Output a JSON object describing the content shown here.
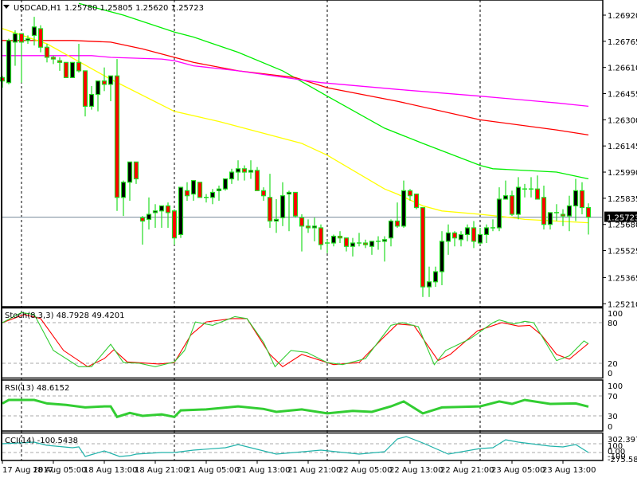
{
  "header": {
    "symbol": "USDCAD,H1",
    "ohlc": "1.25780 1.25805 1.25620 1.25723"
  },
  "colors": {
    "bull_body": "#000000",
    "bear_body": "#ff0000",
    "candle_outline": "#22dd22",
    "ma_green": "#00ee00",
    "ma_red": "#ff0000",
    "ma_magenta": "#ff00ff",
    "ma_yellow": "#ffff00",
    "stoch_main": "#32cd32",
    "stoch_signal": "#ff0000",
    "rsi": "#32cd32",
    "cci": "#20b2aa",
    "last_price_line": "#778899"
  },
  "price_axis": {
    "labels": [
      "1.26920",
      "1.26765",
      "1.26610",
      "1.26455",
      "1.26300",
      "1.26145",
      "1.25990",
      "1.25835",
      "1.25680",
      "1.25525",
      "1.25365",
      "1.25210"
    ],
    "last_price": "1.25723"
  },
  "time_axis": {
    "labels": [
      {
        "text": "17 Aug 2017",
        "candle": 0
      },
      {
        "text": "18 Aug 05:00",
        "candle": 8
      },
      {
        "text": "18 Aug 13:00",
        "candle": 16
      },
      {
        "text": "18 Aug 21:00",
        "candle": 24
      },
      {
        "text": "21 Aug 05:00",
        "candle": 32
      },
      {
        "text": "21 Aug 13:00",
        "candle": 40
      },
      {
        "text": "21 Aug 21:00",
        "candle": 48
      },
      {
        "text": "22 Aug 05:00",
        "candle": 56
      },
      {
        "text": "22 Aug 13:00",
        "candle": 64
      },
      {
        "text": "22 Aug 21:00",
        "candle": 72
      },
      {
        "text": "23 Aug 05:00",
        "candle": 80
      },
      {
        "text": "23 Aug 13:00",
        "candle": 88
      }
    ],
    "day_separators": [
      3,
      27,
      51,
      75
    ]
  },
  "chart_data": {
    "type": "candlestick",
    "title": "USDCAD,H1",
    "ylim": [
      1.2521,
      1.2692
    ],
    "candles": [
      [
        1.2655,
        1.2656,
        1.2649,
        1.2653
      ],
      [
        1.2652,
        1.2678,
        1.2651,
        1.2677
      ],
      [
        1.2676,
        1.2683,
        1.2662,
        1.2681
      ],
      [
        1.2681,
        1.2681,
        1.2652,
        1.2676
      ],
      [
        1.2677,
        1.268,
        1.2675,
        1.2678
      ],
      [
        1.268,
        1.2691,
        1.2674,
        1.2685
      ],
      [
        1.2684,
        1.2686,
        1.267,
        1.2673
      ],
      [
        1.2673,
        1.2675,
        1.2664,
        1.2667
      ],
      [
        1.2667,
        1.2668,
        1.2663,
        1.2666
      ],
      [
        1.2665,
        1.2667,
        1.2659,
        1.2664
      ],
      [
        1.2664,
        1.2664,
        1.2655,
        1.2655
      ],
      [
        1.2655,
        1.2664,
        1.2655,
        1.2664
      ],
      [
        1.2664,
        1.2675,
        1.2658,
        1.2659
      ],
      [
        1.2659,
        1.2659,
        1.2632,
        1.2638
      ],
      [
        1.2638,
        1.265,
        1.2636,
        1.2645
      ],
      [
        1.2645,
        1.2653,
        1.2635,
        1.2653
      ],
      [
        1.2653,
        1.2661,
        1.2647,
        1.2651
      ],
      [
        1.2651,
        1.2656,
        1.2641,
        1.2656
      ],
      [
        1.2656,
        1.2666,
        1.2576,
        1.2584
      ],
      [
        1.2584,
        1.2594,
        1.2573,
        1.2593
      ],
      [
        1.2593,
        1.2605,
        1.2582,
        1.2605
      ],
      [
        1.2605,
        1.2605,
        1.2592,
        1.2595
      ],
      [
        1.2572,
        1.2573,
        1.2556,
        1.257
      ],
      [
        1.2571,
        1.2584,
        1.2565,
        1.2574
      ],
      [
        1.2575,
        1.258,
        1.2566,
        1.2576
      ],
      [
        1.2576,
        1.2579,
        1.2566,
        1.2579
      ],
      [
        1.2579,
        1.2581,
        1.2566,
        1.2575
      ],
      [
        1.2576,
        1.2577,
        1.2556,
        1.256
      ],
      [
        1.2562,
        1.259,
        1.256,
        1.259
      ],
      [
        1.2588,
        1.2593,
        1.2582,
        1.2585
      ],
      [
        1.2586,
        1.2594,
        1.2582,
        1.2594
      ],
      [
        1.2593,
        1.2593,
        1.2584,
        1.2584
      ],
      [
        1.2584,
        1.2586,
        1.2581,
        1.2584
      ],
      [
        1.2584,
        1.2589,
        1.258,
        1.2587
      ],
      [
        1.2588,
        1.2591,
        1.2582,
        1.2589
      ],
      [
        1.2589,
        1.2595,
        1.2588,
        1.2595
      ],
      [
        1.2595,
        1.2601,
        1.2592,
        1.2599
      ],
      [
        1.2599,
        1.2606,
        1.2594,
        1.2601
      ],
      [
        1.2601,
        1.2603,
        1.2594,
        1.2599
      ],
      [
        1.2599,
        1.2606,
        1.2595,
        1.26
      ],
      [
        1.26,
        1.2602,
        1.2588,
        1.2588
      ],
      [
        1.2588,
        1.259,
        1.2582,
        1.2585
      ],
      [
        1.2584,
        1.2598,
        1.2566,
        1.257
      ],
      [
        1.257,
        1.2583,
        1.2563,
        1.2571
      ],
      [
        1.2572,
        1.2593,
        1.2567,
        1.2585
      ],
      [
        1.2586,
        1.2588,
        1.2564,
        1.2587
      ],
      [
        1.2587,
        1.2587,
        1.2572,
        1.2573
      ],
      [
        1.2572,
        1.2574,
        1.2552,
        1.2567
      ],
      [
        1.2567,
        1.2571,
        1.2563,
        1.2566
      ],
      [
        1.2566,
        1.2572,
        1.2558,
        1.2567
      ],
      [
        1.2566,
        1.2568,
        1.2553,
        1.2556
      ],
      [
        1.2557,
        1.2559,
        1.2551,
        1.2557
      ],
      [
        1.2557,
        1.2562,
        1.2555,
        1.2561
      ],
      [
        1.2561,
        1.2564,
        1.2557,
        1.256
      ],
      [
        1.256,
        1.256,
        1.2552,
        1.2555
      ],
      [
        1.2555,
        1.256,
        1.2549,
        1.2557
      ],
      [
        1.2557,
        1.2563,
        1.2555,
        1.2557
      ],
      [
        1.2557,
        1.2559,
        1.2554,
        1.2556
      ],
      [
        1.2555,
        1.2558,
        1.255,
        1.2558
      ],
      [
        1.2558,
        1.2561,
        1.2553,
        1.2558
      ],
      [
        1.2558,
        1.2561,
        1.2546,
        1.2559
      ],
      [
        1.256,
        1.2571,
        1.2555,
        1.257
      ],
      [
        1.257,
        1.2581,
        1.2566,
        1.2567
      ],
      [
        1.2567,
        1.2594,
        1.2566,
        1.2588
      ],
      [
        1.2588,
        1.2589,
        1.2582,
        1.2585
      ],
      [
        1.2586,
        1.2586,
        1.2577,
        1.2578
      ],
      [
        1.2578,
        1.2578,
        1.2525,
        1.2531
      ],
      [
        1.2531,
        1.2543,
        1.2525,
        1.2534
      ],
      [
        1.2534,
        1.2543,
        1.2531,
        1.254
      ],
      [
        1.254,
        1.2564,
        1.2532,
        1.2558
      ],
      [
        1.2558,
        1.2568,
        1.255,
        1.2563
      ],
      [
        1.2563,
        1.2564,
        1.2555,
        1.256
      ],
      [
        1.2559,
        1.2564,
        1.2555,
        1.2562
      ],
      [
        1.2562,
        1.2568,
        1.2558,
        1.2566
      ],
      [
        1.2566,
        1.257,
        1.2554,
        1.2558
      ],
      [
        1.2557,
        1.2566,
        1.2556,
        1.2562
      ],
      [
        1.2562,
        1.2568,
        1.2557,
        1.2566
      ],
      [
        1.2566,
        1.2571,
        1.2564,
        1.2566
      ],
      [
        1.2566,
        1.259,
        1.2564,
        1.2583
      ],
      [
        1.2583,
        1.2594,
        1.2583,
        1.2585
      ],
      [
        1.2585,
        1.2588,
        1.2573,
        1.2574
      ],
      [
        1.2574,
        1.2596,
        1.2571,
        1.259
      ],
      [
        1.2589,
        1.2592,
        1.2584,
        1.2589
      ],
      [
        1.2589,
        1.2596,
        1.2584,
        1.2589
      ],
      [
        1.2589,
        1.2597,
        1.2583,
        1.2583
      ],
      [
        1.2584,
        1.2591,
        1.2565,
        1.2568
      ],
      [
        1.2568,
        1.2575,
        1.2565,
        1.2575
      ],
      [
        1.2575,
        1.258,
        1.257,
        1.2575
      ],
      [
        1.2574,
        1.2577,
        1.2567,
        1.2573
      ],
      [
        1.2573,
        1.2585,
        1.2564,
        1.2579
      ],
      [
        1.2579,
        1.2595,
        1.257,
        1.2588
      ],
      [
        1.2588,
        1.2593,
        1.2574,
        1.2578
      ],
      [
        1.2578,
        1.25805,
        1.2562,
        1.25723
      ]
    ],
    "moving_averages": [
      {
        "name": "ma-green",
        "points": [
          [
            12,
            1.2699
          ],
          [
            19,
            1.2692
          ],
          [
            27,
            1.2682
          ],
          [
            30,
            1.2679
          ],
          [
            37,
            1.267
          ],
          [
            44,
            1.2659
          ],
          [
            51,
            1.2644
          ],
          [
            60,
            1.2625
          ],
          [
            66,
            1.2616
          ],
          [
            75,
            1.2603
          ],
          [
            77,
            1.2601
          ],
          [
            87,
            1.2599
          ],
          [
            92,
            1.2595
          ]
        ]
      },
      {
        "name": "ma-red",
        "points": [
          [
            0,
            1.2677
          ],
          [
            7,
            1.2677
          ],
          [
            11,
            1.2677
          ],
          [
            17,
            1.2676
          ],
          [
            22,
            1.2672
          ],
          [
            27,
            1.2667
          ],
          [
            30,
            1.2664
          ],
          [
            37,
            1.2659
          ],
          [
            46,
            1.2655
          ],
          [
            51,
            1.2649
          ],
          [
            62,
            1.2641
          ],
          [
            75,
            1.263
          ],
          [
            87,
            1.2624
          ],
          [
            92,
            1.2621
          ]
        ]
      },
      {
        "name": "ma-magenta",
        "points": [
          [
            0,
            1.2668
          ],
          [
            14,
            1.2668
          ],
          [
            17,
            1.2667
          ],
          [
            25,
            1.2666
          ],
          [
            27,
            1.2665
          ],
          [
            30,
            1.2662
          ],
          [
            37,
            1.2659
          ],
          [
            50,
            1.2652
          ],
          [
            62,
            1.2648
          ],
          [
            75,
            1.2644
          ],
          [
            87,
            1.264
          ],
          [
            92,
            1.2638
          ]
        ]
      },
      {
        "name": "ma-yellow",
        "points": [
          [
            0,
            1.2684
          ],
          [
            7,
            1.2675
          ],
          [
            17,
            1.2654
          ],
          [
            27,
            1.2635
          ],
          [
            34,
            1.2629
          ],
          [
            47,
            1.2616
          ],
          [
            51,
            1.2609
          ],
          [
            60,
            1.2589
          ],
          [
            62,
            1.2586
          ],
          [
            66,
            1.2579
          ],
          [
            69,
            1.2576
          ],
          [
            75,
            1.2574
          ],
          [
            80,
            1.2572
          ],
          [
            82,
            1.2571
          ],
          [
            87,
            1.257
          ],
          [
            92,
            1.2569
          ]
        ]
      }
    ],
    "stochastic": {
      "label": "Stoch(8,3,3) 48.7928 49.4201",
      "levels": [
        "100",
        "80",
        "20",
        "0"
      ],
      "main": [
        [
          0,
          80
        ],
        [
          3,
          95
        ],
        [
          5,
          92
        ],
        [
          8,
          39
        ],
        [
          12,
          15
        ],
        [
          14,
          15
        ],
        [
          17,
          48
        ],
        [
          19,
          21
        ],
        [
          21.5,
          20
        ],
        [
          24,
          15
        ],
        [
          27,
          22
        ],
        [
          28.6,
          39
        ],
        [
          30.3,
          81
        ],
        [
          33,
          76
        ],
        [
          36.5,
          89
        ],
        [
          38.4,
          86
        ],
        [
          41,
          51
        ],
        [
          42.8,
          15
        ],
        [
          45.3,
          39
        ],
        [
          47.8,
          36
        ],
        [
          51,
          21
        ],
        [
          53.4,
          18
        ],
        [
          57,
          27
        ],
        [
          61,
          76
        ],
        [
          62.8,
          80
        ],
        [
          65.3,
          74
        ],
        [
          67.8,
          18
        ],
        [
          69.6,
          39
        ],
        [
          73.4,
          56
        ],
        [
          77,
          80
        ],
        [
          78,
          84
        ],
        [
          80.3,
          78
        ],
        [
          82,
          82
        ],
        [
          83.4,
          80
        ],
        [
          87,
          24
        ],
        [
          89,
          31
        ],
        [
          91.3,
          53
        ],
        [
          92,
          48.79
        ]
      ],
      "signal": [
        [
          0,
          80
        ],
        [
          3.4,
          92
        ],
        [
          6,
          86
        ],
        [
          9.6,
          39
        ],
        [
          13.4,
          15
        ],
        [
          16,
          27
        ],
        [
          17.5,
          40
        ],
        [
          19.6,
          22
        ],
        [
          24.6,
          19
        ],
        [
          27,
          21
        ],
        [
          29.6,
          62
        ],
        [
          32,
          81
        ],
        [
          36,
          86
        ],
        [
          38.4,
          86
        ],
        [
          42,
          33
        ],
        [
          44,
          15
        ],
        [
          47,
          33
        ],
        [
          52,
          18
        ],
        [
          56,
          21
        ],
        [
          59.6,
          56
        ],
        [
          62,
          78
        ],
        [
          64.6,
          76
        ],
        [
          68.4,
          24
        ],
        [
          70.3,
          33
        ],
        [
          74.6,
          68
        ],
        [
          78.4,
          80
        ],
        [
          81,
          75
        ],
        [
          82.8,
          76
        ],
        [
          84.6,
          62
        ],
        [
          87,
          33
        ],
        [
          89,
          26
        ],
        [
          92,
          49.42
        ]
      ]
    },
    "rsi": {
      "label": "RSI(13) 48.6152",
      "levels": [
        "100",
        "70",
        "30",
        "0"
      ],
      "values": [
        [
          0,
          55
        ],
        [
          1,
          62
        ],
        [
          5,
          62
        ],
        [
          7,
          55
        ],
        [
          10,
          52
        ],
        [
          13,
          47
        ],
        [
          16,
          49
        ],
        [
          17,
          49
        ],
        [
          18,
          28
        ],
        [
          20,
          36
        ],
        [
          22,
          30
        ],
        [
          25,
          33
        ],
        [
          27,
          28
        ],
        [
          28,
          41
        ],
        [
          32,
          43
        ],
        [
          37,
          49
        ],
        [
          41,
          44
        ],
        [
          43,
          38
        ],
        [
          47,
          43
        ],
        [
          51,
          35
        ],
        [
          55,
          40
        ],
        [
          58,
          38
        ],
        [
          61,
          49
        ],
        [
          63,
          59
        ],
        [
          66,
          35
        ],
        [
          69,
          47
        ],
        [
          75,
          49
        ],
        [
          78,
          59
        ],
        [
          80,
          54
        ],
        [
          82,
          62
        ],
        [
          86,
          54
        ],
        [
          90,
          55
        ],
        [
          92,
          48.62
        ]
      ]
    },
    "cci": {
      "label": "CCI(14) -100.5438",
      "levels": [
        "302.3977",
        "100",
        "0.00",
        "-100",
        "-275.5808"
      ],
      "values": [
        [
          0,
          100
        ],
        [
          5,
          136
        ],
        [
          7,
          64
        ],
        [
          11,
          9
        ],
        [
          12,
          30
        ],
        [
          13,
          -190
        ],
        [
          16,
          -64
        ],
        [
          18.4,
          -190
        ],
        [
          20,
          -170
        ],
        [
          21,
          -136
        ],
        [
          25,
          -100
        ],
        [
          27,
          -100
        ],
        [
          30,
          -45
        ],
        [
          35,
          9
        ],
        [
          37,
          82
        ],
        [
          43,
          -136
        ],
        [
          50,
          -45
        ],
        [
          56,
          -136
        ],
        [
          60,
          -82
        ],
        [
          62,
          209
        ],
        [
          63.4,
          264
        ],
        [
          66,
          118
        ],
        [
          70,
          -136
        ],
        [
          75,
          -9
        ],
        [
          77,
          9
        ],
        [
          79,
          191
        ],
        [
          81,
          136
        ],
        [
          83,
          100
        ],
        [
          86,
          45
        ],
        [
          88,
          27
        ],
        [
          90,
          82
        ],
        [
          92,
          -100.54
        ]
      ]
    }
  }
}
